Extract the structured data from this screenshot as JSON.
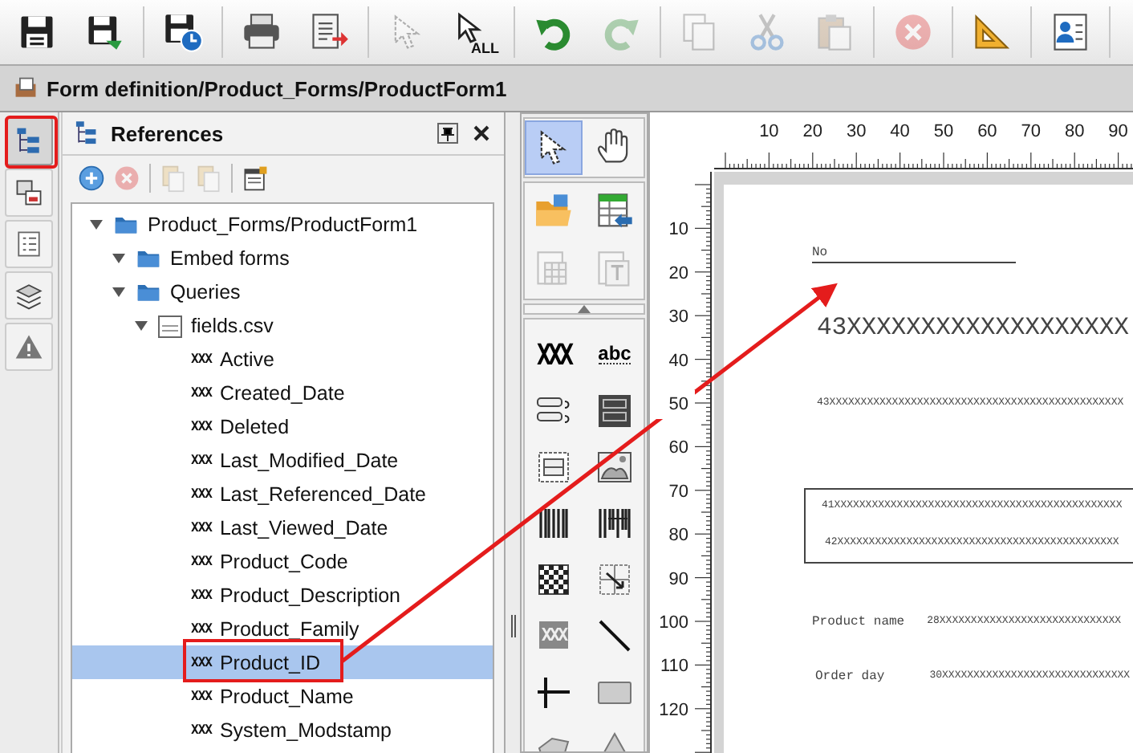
{
  "toolbar": [
    [
      {
        "kind": "save",
        "disabled": false
      },
      {
        "kind": "save-arrow",
        "disabled": false
      }
    ],
    [
      {
        "kind": "save-clock",
        "disabled": false
      }
    ],
    [
      {
        "kind": "print",
        "disabled": false
      },
      {
        "kind": "export",
        "disabled": false
      }
    ],
    [
      {
        "kind": "pointer",
        "disabled": true
      },
      {
        "kind": "pointer-all",
        "label": "ALL",
        "disabled": false
      }
    ],
    [
      {
        "kind": "undo",
        "disabled": false
      },
      {
        "kind": "redo",
        "disabled": true
      }
    ],
    [
      {
        "kind": "copy",
        "disabled": true
      },
      {
        "kind": "cut",
        "disabled": true
      },
      {
        "kind": "paste",
        "disabled": true
      }
    ],
    [
      {
        "kind": "delete",
        "disabled": true
      }
    ],
    [
      {
        "kind": "triangle-ruler",
        "disabled": false
      }
    ],
    [
      {
        "kind": "id-card",
        "disabled": false
      }
    ]
  ],
  "title_bar": {
    "title": "Form definition/Product_Forms/ProductForm1"
  },
  "sidebar": {
    "items": [
      {
        "kind": "tree",
        "selected": true
      },
      {
        "kind": "copy-move",
        "selected": false
      },
      {
        "kind": "list",
        "selected": false
      },
      {
        "kind": "layers",
        "selected": false
      },
      {
        "kind": "warning",
        "selected": false
      }
    ]
  },
  "references": {
    "title": "References",
    "toolbar": [
      {
        "kind": "add",
        "disabled": false
      },
      {
        "kind": "remove",
        "disabled": true
      },
      {
        "kind": "doc",
        "disabled": true
      },
      {
        "kind": "doc",
        "disabled": true
      },
      {
        "kind": "properties",
        "disabled": false
      }
    ],
    "tree": [
      {
        "label": "Product_Forms/ProductForm1",
        "kind": "folder",
        "expanded": true,
        "selected": false,
        "children": [
          {
            "label": "Embed forms",
            "kind": "folder",
            "expanded": true,
            "selected": false
          },
          {
            "label": "Queries",
            "kind": "folder",
            "expanded": true,
            "selected": false,
            "children": [
              {
                "label": "fields.csv",
                "kind": "sql",
                "expanded": true,
                "selected": false,
                "children": [
                  {
                    "label": "Active",
                    "kind": "field",
                    "glyph": "XXX",
                    "selected": false
                  },
                  {
                    "label": "Created_Date",
                    "kind": "field",
                    "glyph": "XXX",
                    "selected": false
                  },
                  {
                    "label": "Deleted",
                    "kind": "field",
                    "glyph": "XXX",
                    "selected": false
                  },
                  {
                    "label": "Last_Modified_Date",
                    "kind": "field",
                    "glyph": "XXX",
                    "selected": false
                  },
                  {
                    "label": "Last_Referenced_Date",
                    "kind": "field",
                    "glyph": "XXX",
                    "selected": false
                  },
                  {
                    "label": "Last_Viewed_Date",
                    "kind": "field",
                    "glyph": "XXX",
                    "selected": false
                  },
                  {
                    "label": "Product_Code",
                    "kind": "field",
                    "glyph": "XXX",
                    "selected": false
                  },
                  {
                    "label": "Product_Description",
                    "kind": "field",
                    "glyph": "XXX",
                    "selected": false
                  },
                  {
                    "label": "Product_Family",
                    "kind": "field",
                    "glyph": "XXX",
                    "selected": false
                  },
                  {
                    "label": "Product_ID",
                    "kind": "field",
                    "glyph": "XXX",
                    "selected": true
                  },
                  {
                    "label": "Product_Name",
                    "kind": "field",
                    "glyph": "XXX",
                    "selected": false
                  },
                  {
                    "label": "System_Modstamp",
                    "kind": "field",
                    "glyph": "XXX",
                    "selected": false
                  }
                ]
              }
            ]
          }
        ]
      }
    ]
  },
  "palette": {
    "modes": [
      {
        "kind": "pointer",
        "selected": true
      },
      {
        "kind": "hand",
        "selected": false
      }
    ],
    "actions": [
      {
        "kind": "folder-open",
        "disabled": false
      },
      {
        "kind": "table-import",
        "disabled": false
      },
      {
        "kind": "page-table",
        "disabled": true
      },
      {
        "kind": "page-text",
        "disabled": true
      }
    ],
    "tools": [
      {
        "kind": "glyph",
        "label": "XXX"
      },
      {
        "kind": "glyph-underlined",
        "label": "abc"
      },
      {
        "kind": "stacked-fields"
      },
      {
        "kind": "dark-frame"
      },
      {
        "kind": "dashed-box"
      },
      {
        "kind": "image"
      },
      {
        "kind": "barcode"
      },
      {
        "kind": "barcode2"
      },
      {
        "kind": "checker"
      },
      {
        "kind": "grid-arrow"
      },
      {
        "kind": "glyph-boxed",
        "label": "XXX"
      },
      {
        "kind": "line"
      },
      {
        "kind": "cross"
      },
      {
        "kind": "rectangle"
      },
      {
        "kind": "polygon"
      },
      {
        "kind": "triangle"
      }
    ]
  },
  "canvas": {
    "top_ruler": [
      "10",
      "20",
      "30",
      "40",
      "50",
      "60",
      "70",
      "80",
      "90"
    ],
    "left_ruler": [
      "10",
      "20",
      "30",
      "40",
      "50",
      "60",
      "70",
      "80",
      "90",
      "100",
      "110",
      "120"
    ],
    "items": [
      {
        "kind": "caption-line",
        "text": "No"
      },
      {
        "kind": "field-large",
        "text": "43XXXXXXXXXXXXXXXXXXX"
      },
      {
        "kind": "field-small",
        "text": "43XXXXXXXXXXXXXXXXXXXXXXXXXXXXXXXXXXXXXXXXXXXXXXX"
      },
      {
        "kind": "boxed-fields",
        "lines": [
          "41XXXXXXXXXXXXXXXXXXXXXXXXXXXXXXXXXXXXXXXXXXXXXX",
          "42XXXXXXXXXXXXXXXXXXXXXXXXXXXXXXXXXXXXXXXXXXXXX"
        ]
      },
      {
        "kind": "labeled-field",
        "label": "Product name",
        "text": "28XXXXXXXXXXXXXXXXXXXXXXXXXXXXX"
      },
      {
        "kind": "labeled-field",
        "label": "Order day",
        "text": "30XXXXXXXXXXXXXXXXXXXXXXXXXXXXXX"
      }
    ]
  }
}
